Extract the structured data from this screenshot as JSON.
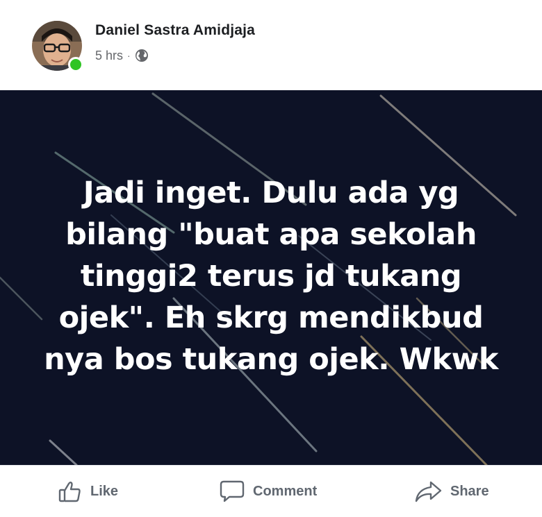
{
  "post": {
    "author": "Daniel Sastra Amidjaja",
    "timestamp": "5 hrs",
    "separator": "·",
    "privacy_icon": "globe-icon",
    "online_status_color": "#2fc424",
    "image_text_lines": [
      "Jadi inget. Dulu ada yg",
      "bilang \"buat apa sekolah",
      "tinggi2 terus jd tukang",
      "ojek\". Eh skrg mendikbud",
      "nya bos tukang ojek. Wkwk"
    ],
    "image_background": "#0d1226"
  },
  "actions": {
    "like": {
      "label": "Like",
      "icon": "thumbs-up-icon"
    },
    "comment": {
      "label": "Comment",
      "icon": "speech-bubble-icon"
    },
    "share": {
      "label": "Share",
      "icon": "share-arrow-icon"
    }
  }
}
